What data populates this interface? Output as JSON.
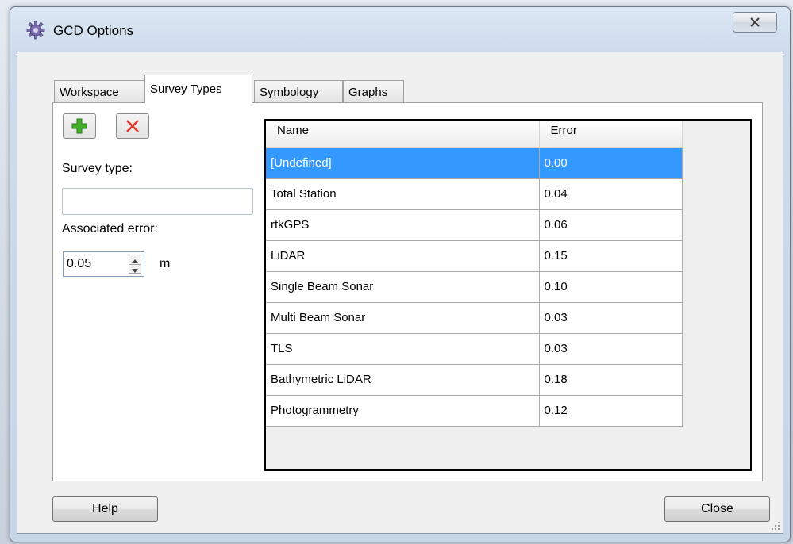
{
  "window": {
    "title": "GCD Options",
    "icon": "gear-icon"
  },
  "tabs": [
    {
      "label": "Workspace",
      "active": false
    },
    {
      "label": "Survey Types",
      "active": true
    },
    {
      "label": "Symbology",
      "active": false
    },
    {
      "label": "Graphs",
      "active": false
    }
  ],
  "survey_form": {
    "add_icon": "plus-icon",
    "delete_icon": "x-icon",
    "survey_type_label": "Survey type:",
    "survey_type_value": "",
    "associated_error_label": "Associated error:",
    "associated_error_value": "0.05",
    "unit": "m"
  },
  "grid": {
    "columns": [
      "Name",
      "Error"
    ],
    "rows": [
      {
        "name": "[Undefined]",
        "error": "0.00",
        "selected": true
      },
      {
        "name": "Total Station",
        "error": "0.04"
      },
      {
        "name": "rtkGPS",
        "error": "0.06"
      },
      {
        "name": "LiDAR",
        "error": "0.15"
      },
      {
        "name": "Single Beam Sonar",
        "error": "0.10"
      },
      {
        "name": "Multi Beam Sonar",
        "error": "0.03"
      },
      {
        "name": "TLS",
        "error": "0.03"
      },
      {
        "name": "Bathymetric LiDAR",
        "error": "0.18"
      },
      {
        "name": "Photogrammetry",
        "error": "0.12"
      }
    ],
    "selection_color": "#3399ff"
  },
  "buttons": {
    "help": "Help",
    "close": "Close"
  }
}
